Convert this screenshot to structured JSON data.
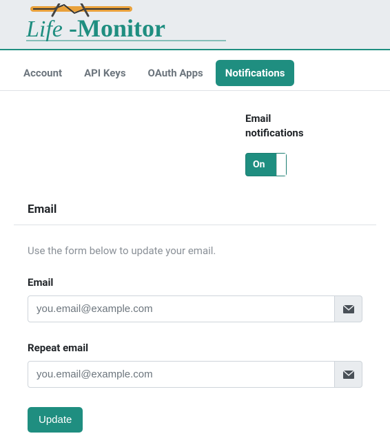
{
  "brand": {
    "name_part1": "Life",
    "name_part2": "-Monitor"
  },
  "tabs": [
    {
      "label": "Account",
      "active": false
    },
    {
      "label": "API Keys",
      "active": false
    },
    {
      "label": "OAuth Apps",
      "active": false
    },
    {
      "label": "Notifications",
      "active": true
    }
  ],
  "toggle": {
    "label": "Email notifications",
    "state_text": "On"
  },
  "section": {
    "title": "Email",
    "help": "Use the form below to update your email."
  },
  "form": {
    "email_label": "Email",
    "email_placeholder": "you.email@example.com",
    "repeat_label": "Repeat email",
    "repeat_placeholder": "you.email@example.com",
    "submit_label": "Update"
  },
  "colors": {
    "accent": "#1f8e80"
  }
}
